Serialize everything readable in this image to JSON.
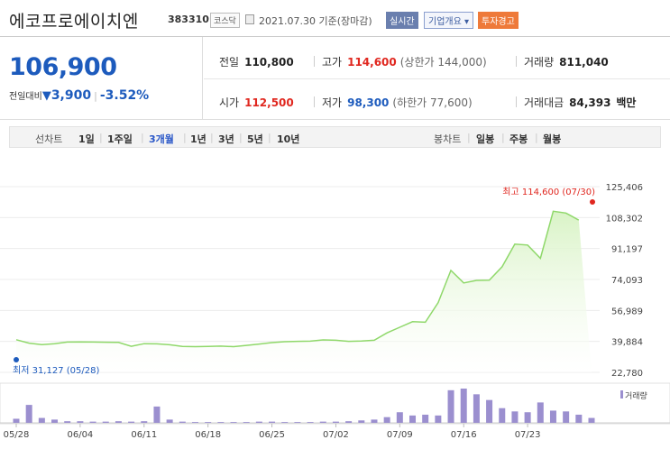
{
  "header": {
    "company_name": "에코프로에이치엔",
    "code": "383310",
    "market": "코스닥",
    "date_text": "2021.07.30 기준(장마감)",
    "realtime_button": "실시간",
    "company_info_button": "기업개요",
    "warning_badge": "투자경고"
  },
  "price": {
    "current": "106,900",
    "change_label": "전일대비",
    "change_arrow": "▼",
    "change_value": "3,900",
    "change_rate": "-3.52%"
  },
  "stats": {
    "prev_close": {
      "label": "전일",
      "value": "110,800"
    },
    "high": {
      "label": "고가",
      "value": "114,600",
      "sub": "(상한가 144,000)"
    },
    "volume": {
      "label": "거래량",
      "value": "811,040"
    },
    "open": {
      "label": "시가",
      "value": "112,500"
    },
    "low": {
      "label": "저가",
      "value": "98,300",
      "sub": "(하한가 77,600)"
    },
    "amount": {
      "label": "거래대금",
      "value": "84,393",
      "unit": "백만"
    }
  },
  "tabs": {
    "line_label": "선차트",
    "periods": [
      "1일",
      "1주일",
      "3개월",
      "1년",
      "3년",
      "5년",
      "10년"
    ],
    "active_period": "3개월",
    "candle_label": "봉차트",
    "candles": [
      "일봉",
      "주봉",
      "월봉"
    ]
  },
  "colors": {
    "line": "#8fd86a",
    "area_top": "#d9f3c6",
    "bar": "#9b8fcf",
    "up": "#e0271f",
    "down": "#1d5bbd"
  },
  "chart_data": {
    "type": "line",
    "x": [
      "05/28",
      "05/31",
      "06/01",
      "06/02",
      "06/03",
      "06/04",
      "06/07",
      "06/08",
      "06/09",
      "06/10",
      "06/11",
      "06/14",
      "06/15",
      "06/16",
      "06/17",
      "06/18",
      "06/21",
      "06/22",
      "06/23",
      "06/24",
      "06/25",
      "06/28",
      "06/29",
      "06/30",
      "07/01",
      "07/02",
      "07/05",
      "07/06",
      "07/07",
      "07/08",
      "07/09",
      "07/12",
      "07/13",
      "07/14",
      "07/15",
      "07/16",
      "07/19",
      "07/20",
      "07/21",
      "07/22",
      "07/23",
      "07/26",
      "07/27",
      "07/28",
      "07/29",
      "07/30"
    ],
    "series": [
      {
        "values": [
          40800,
          38900,
          38100,
          38600,
          39500,
          39600,
          39500,
          39400,
          39300,
          37200,
          38600,
          38500,
          38000,
          37100,
          37000,
          37100,
          37300,
          37000,
          37700,
          38400,
          39200,
          39700,
          39900,
          40000,
          40700,
          40500,
          39900,
          40100,
          40500,
          44600,
          47700,
          50800,
          50500,
          61300,
          79100,
          72200,
          73600,
          73700,
          81100,
          93600,
          93100,
          85800,
          111800,
          110800,
          106900
        ]
      }
    ],
    "volume": [
      50,
      220,
      60,
      40,
      20,
      20,
      15,
      15,
      20,
      15,
      20,
      200,
      40,
      15,
      10,
      10,
      10,
      10,
      10,
      15,
      15,
      10,
      10,
      10,
      15,
      15,
      20,
      30,
      40,
      70,
      130,
      90,
      100,
      90,
      400,
      420,
      350,
      280,
      180,
      140,
      130,
      250,
      150,
      140,
      100,
      60
    ],
    "y_ticks": [
      "125,406",
      "108,302",
      "91,197",
      "74,093",
      "56,989",
      "39,884",
      "22,780"
    ],
    "ylim": [
      22780,
      125406
    ],
    "x_ticks": [
      "05/28",
      "06/04",
      "06/11",
      "06/18",
      "06/25",
      "07/02",
      "07/09",
      "07/16",
      "07/23"
    ],
    "max_label": "최고 114,600 (07/30)",
    "min_label": "최저 31,127 (05/28)",
    "volume_legend": "거래량"
  }
}
